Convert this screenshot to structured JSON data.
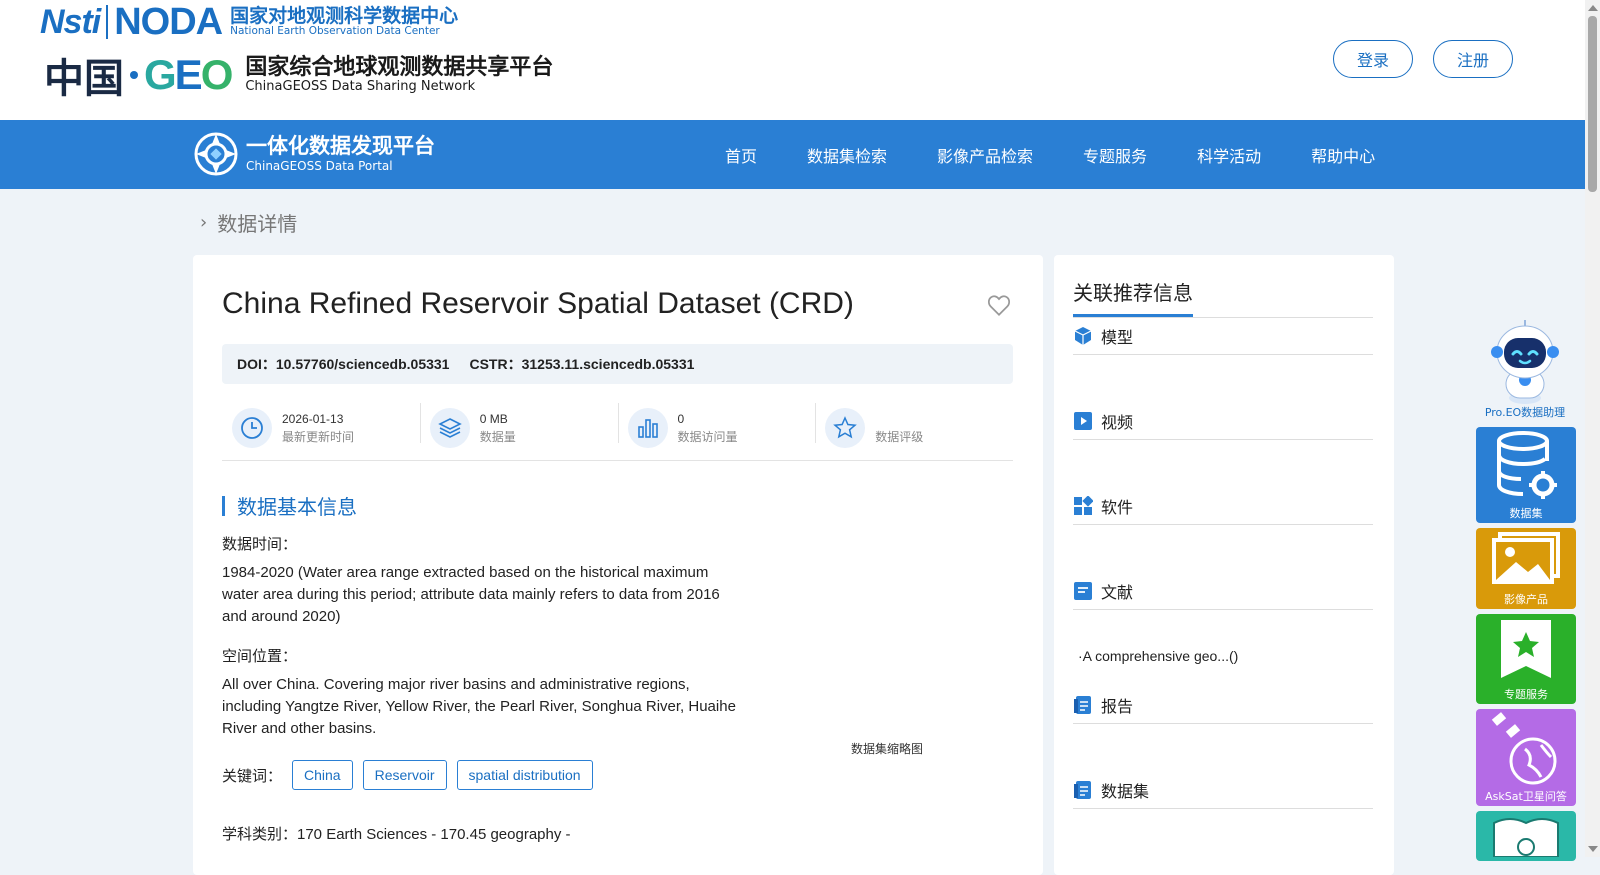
{
  "header": {
    "noda_logo_left": "Nsti",
    "noda_logo_word": "NODA",
    "noda_cn": "国家对地观测科学数据中心",
    "noda_en": "National Earth Observation Data Center",
    "geo_cn": "中国",
    "geo_word": "GEO",
    "geo_platform_cn": "国家综合地球观测数据共享平台",
    "geo_platform_en": "ChinaGEOSS Data Sharing Network",
    "login_label": "登录",
    "register_label": "注册"
  },
  "nav": {
    "portal_cn": "一体化数据发现平台",
    "portal_en": "ChinaGEOSS Data Portal",
    "items": [
      "首页",
      "数据集检索",
      "影像产品检索",
      "专题服务",
      "科学活动",
      "帮助中心"
    ]
  },
  "breadcrumb": {
    "current": "数据详情"
  },
  "dataset": {
    "title": "China Refined Reservoir Spatial Dataset (CRD)",
    "doi_label": "DOI：",
    "doi_value": "10.57760/sciencedb.05331",
    "cstr_label": "CSTR：",
    "cstr_value": "31253.11.sciencedb.05331",
    "stats": [
      {
        "icon": "clock-icon",
        "value": "2026-01-13",
        "label": "最新更新时间"
      },
      {
        "icon": "layers-icon",
        "value": "0 MB",
        "label": "数据量"
      },
      {
        "icon": "bar-chart-icon",
        "value": "0",
        "label": "数据访问量"
      },
      {
        "icon": "star-icon",
        "value": "",
        "label": "数据评级"
      }
    ],
    "section_title": "数据基本信息",
    "time_label": "数据时间：",
    "time_value": "1984-2020 (Water area range extracted based on the historical maximum water area during this period; attribute data mainly refers to data from 2016 and around 2020)",
    "location_label": "空间位置：",
    "location_value": "All over China. Covering major river basins and administrative regions, including Yangtze River, Yellow River, the Pearl River, Songhua River, Huaihe River and other basins.",
    "keywords_label": "关键词：",
    "keywords": [
      "China",
      "Reservoir",
      "spatial distribution"
    ],
    "subject_text": "学科类别：170 Earth Sciences - 170.45 geography -",
    "thumbnail_caption": "数据集缩略图"
  },
  "related": {
    "title": "关联推荐信息",
    "sections": [
      {
        "icon": "cube-icon",
        "label": "模型"
      },
      {
        "icon": "play-icon",
        "label": "视频"
      },
      {
        "icon": "apps-icon",
        "label": "软件"
      },
      {
        "icon": "document-icon",
        "label": "文献"
      },
      {
        "icon": "report-icon",
        "label": "报告"
      },
      {
        "icon": "dataset-icon",
        "label": "数据集"
      }
    ],
    "literature_item": "·A comprehensive geo...()"
  },
  "tools": {
    "assistant_label": "Pro.EO数据助理",
    "items": [
      {
        "label": "数据集",
        "color": "#2a7fd4"
      },
      {
        "label": "影像产品",
        "color": "#d99a0a"
      },
      {
        "label": "专题服务",
        "color": "#2ab02a"
      },
      {
        "label": "AskSat卫星问答",
        "color": "#b46be6"
      },
      {
        "label": "",
        "color": "#2ab8a8"
      }
    ]
  }
}
